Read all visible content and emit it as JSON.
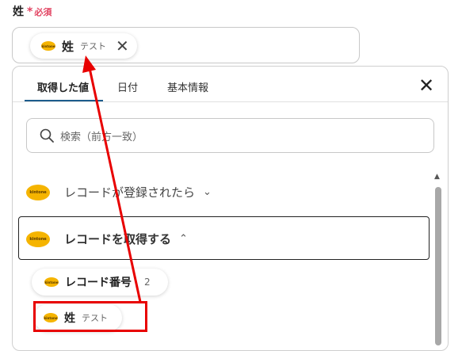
{
  "field": {
    "label": "姓",
    "required_mark": "*",
    "required_text": "必須"
  },
  "selected_chip": {
    "icon": "kintone-icon",
    "title": "姓",
    "subtitle": "テスト",
    "close_icon": "close-icon"
  },
  "tabs": [
    {
      "label": "取得した値",
      "active": true
    },
    {
      "label": "日付",
      "active": false
    },
    {
      "label": "基本情報",
      "active": false
    }
  ],
  "search": {
    "placeholder": "検索（前方一致）"
  },
  "groups": [
    {
      "label": "レコードが登録されたら",
      "expanded": false,
      "icon": "kintone-icon"
    },
    {
      "label": "レコードを取得する",
      "expanded": true,
      "icon": "kintone-icon"
    }
  ],
  "options": [
    {
      "title": "レコード番号",
      "value": "2",
      "icon": "kintone-icon"
    },
    {
      "title": "姓",
      "value": "テスト",
      "icon": "kintone-icon"
    }
  ],
  "colors": {
    "required": "#e24462",
    "tab_underline": "#1d5c8c",
    "kintone_icon": "#f5b400",
    "annotation_red": "#e80000"
  }
}
